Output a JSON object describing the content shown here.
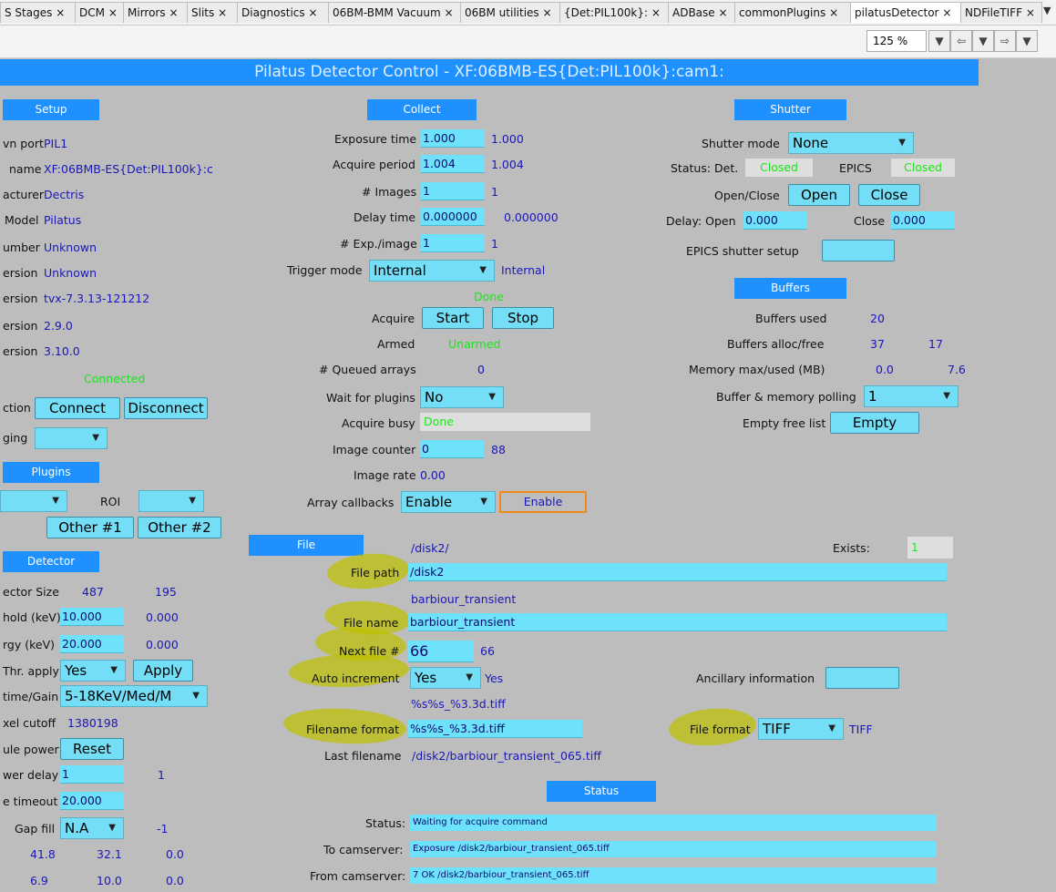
{
  "tabs": [
    "S Stages",
    "DCM",
    "Mirrors",
    "Slits",
    "Diagnostics",
    "06BM-BMM Vacuum",
    "06BM utilities",
    "{Det:PIL100k}:",
    "ADBase",
    "commonPlugins",
    "pilatusDetector",
    "NDFileTIFF"
  ],
  "close_glyph": "×",
  "toolbar": {
    "zoom": "125 %"
  },
  "title": "Pilatus Detector Control - XF:06BMB-ES{Det:PIL100k}:cam1:",
  "setup": {
    "header": "Setup",
    "rows": [
      {
        "label": "vn port",
        "value": "PIL1"
      },
      {
        "label": "name",
        "value": "XF:06BMB-ES{Det:PIL100k}:c"
      },
      {
        "label": "acturer",
        "value": "Dectris"
      },
      {
        "label": "Model",
        "value": "Pilatus"
      },
      {
        "label": "umber",
        "value": "Unknown"
      },
      {
        "label": "ersion",
        "value": "Unknown"
      },
      {
        "label": "ersion",
        "value": "tvx-7.3.13-121212"
      },
      {
        "label": "ersion",
        "value": "2.9.0"
      },
      {
        "label": "ersion",
        "value": "3.10.0"
      }
    ],
    "status": "Connected",
    "connection_label": "ction",
    "connect": "Connect",
    "disconnect": "Disconnect",
    "debug_label": "ging"
  },
  "plugins": {
    "header": "Plugins",
    "roi_label": "ROI",
    "other1": "Other #1",
    "other2": "Other #2"
  },
  "detector": {
    "header": "Detector",
    "size_label": "ector Size",
    "size_x": "487",
    "size_y": "195",
    "threshold_label": "hold (keV)",
    "threshold_set": "10.000",
    "threshold_rbv": "0.000",
    "energy_label": "rgy (keV)",
    "energy_set": "20.000",
    "energy_rbv": "0.000",
    "thr_apply_label": "Thr. apply",
    "thr_apply_value": "Yes",
    "apply": "Apply",
    "gain_label": "time/Gain",
    "gain_value": "5-18KeV/Med/M",
    "pixel_cutoff_label": "xel cutoff",
    "pixel_cutoff": "1380198",
    "module_power_label": "ule power",
    "reset": "Reset",
    "power_delay_label": "wer delay",
    "power_delay_set": "1",
    "power_delay_rbv": "1",
    "timeout_label": "e timeout",
    "timeout": "20.000",
    "gap_fill_label": "Gap fill",
    "gap_fill": "N.A",
    "gap_fill_rbv": "-1",
    "temp_row": [
      "41.8",
      "32.1",
      "0.0"
    ],
    "humid_row": [
      "6.9",
      "10.0",
      "0.0"
    ]
  },
  "collect": {
    "header": "Collect",
    "exposure_label": "Exposure time",
    "exposure_set": "1.000",
    "exposure_rbv": "1.000",
    "period_label": "Acquire period",
    "period_set": "1.004",
    "period_rbv": "1.004",
    "images_label": "# Images",
    "images_set": "1",
    "images_rbv": "1",
    "delay_label": "Delay time",
    "delay_set": "0.000000",
    "delay_rbv": "0.000000",
    "exp_image_label": "# Exp./image",
    "exp_image_set": "1",
    "exp_image_rbv": "1",
    "trigger_label": "Trigger mode",
    "trigger_value": "Internal",
    "trigger_rbv": "Internal",
    "acq_status": "Done",
    "acquire_label": "Acquire",
    "start": "Start",
    "stop": "Stop",
    "armed_label": "Armed",
    "armed_value": "Unarmed",
    "queued_label": "# Queued arrays",
    "queued_value": "0",
    "wait_label": "Wait for plugins",
    "wait_value": "No",
    "busy_label": "Acquire busy",
    "busy_value": "Done",
    "counter_label": "Image counter",
    "counter_set": "0",
    "counter_rbv": "88",
    "rate_label": "Image rate",
    "rate_value": "0.00",
    "callbacks_label": "Array callbacks",
    "callbacks_value": "Enable",
    "callbacks_rbv": "Enable"
  },
  "shutter": {
    "header": "Shutter",
    "mode_label": "Shutter mode",
    "mode_value": "None",
    "status_label": "Status: Det.",
    "status_det": "Closed",
    "epics_label": "EPICS",
    "status_epics": "Closed",
    "openclose_label": "Open/Close",
    "open": "Open",
    "close": "Close",
    "delay_open_label": "Delay: Open",
    "delay_open": "0.000",
    "close_label": "Close",
    "delay_close": "0.000",
    "setup_label": "EPICS shutter setup"
  },
  "buffers": {
    "header": "Buffers",
    "used_label": "Buffers used",
    "used": "20",
    "alloc_label": "Buffers alloc/free",
    "alloc": "37",
    "free": "17",
    "memory_label": "Memory max/used (MB)",
    "mem_max": "0.0",
    "mem_used": "7.6",
    "polling_label": "Buffer & memory polling",
    "polling_value": "1",
    "empty_label": "Empty free list",
    "empty": "Empty"
  },
  "file": {
    "header": "File",
    "path_rbv": "/disk2/",
    "exists_label": "Exists:",
    "exists_value": "1",
    "path_label": "File path",
    "path_value": "/disk2",
    "name_rbv": "barbiour_transient",
    "name_label": "File name",
    "name_value": "barbiour_transient",
    "next_label": "Next file #",
    "next_set": "66",
    "next_rbv": "66",
    "autoinc_label": "Auto increment",
    "autoinc_value": "Yes",
    "autoinc_rbv": "Yes",
    "ancillary_label": "Ancillary information",
    "format_rbv": "%s%s_%3.3d.tiff",
    "format_label": "Filename format",
    "format_value": "%s%s_%3.3d.tiff",
    "fileformat_label": "File format",
    "fileformat_value": "TIFF",
    "fileformat_rbv": "TIFF",
    "last_label": "Last filename",
    "last_value": "/disk2/barbiour_transient_065.tiff"
  },
  "status": {
    "header": "Status",
    "status_label": "Status:",
    "status_value": "Waiting for acquire command",
    "to_label": "To camserver:",
    "to_value": "Exposure /disk2/barbiour_transient_065.tiff",
    "from_label": "From camserver:",
    "from_value": "7 OK /disk2/barbiour_transient_065.tiff"
  },
  "colors": {
    "header": "#1e90ff",
    "input": "#6fe2fb",
    "readback": "#1a17b8",
    "panel": "#bdbdbd",
    "ok": "#17e817",
    "highlight": "#bcc000",
    "focus": "#ef8a1a"
  },
  "icons": {
    "dropdown": "▼",
    "back": "⇦",
    "forward": "⇨"
  }
}
